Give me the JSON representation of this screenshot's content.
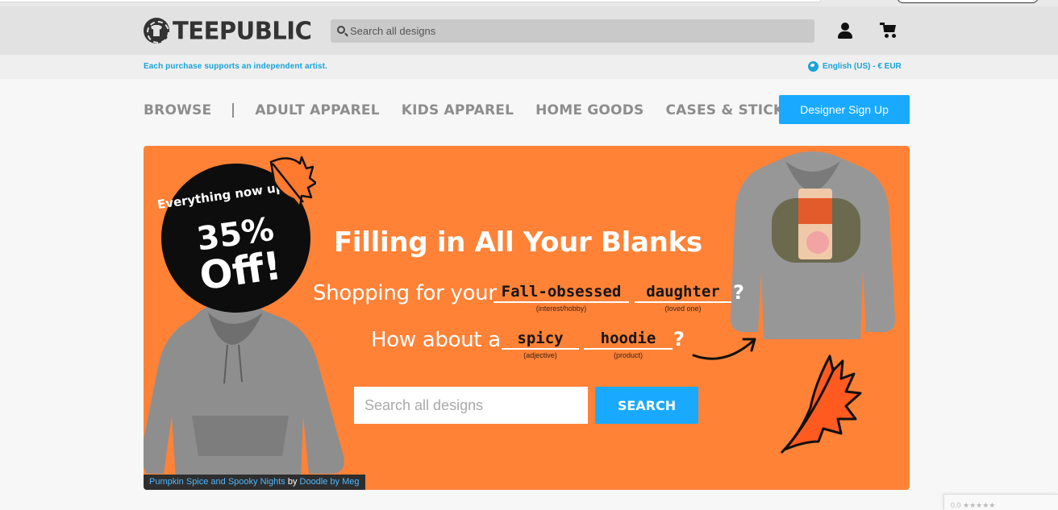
{
  "header": {
    "logo_text": "TEEPUBLIC",
    "search_placeholder": "Search all designs"
  },
  "substrip": {
    "tagline": "Each purchase supports an independent artist.",
    "locale": "English (US) - € EUR"
  },
  "nav": {
    "browse": "BROWSE",
    "items": [
      "ADULT APPAREL",
      "KIDS APPAREL",
      "HOME GOODS",
      "CASES & STICKERS"
    ],
    "signup_label": "Designer Sign Up"
  },
  "banner": {
    "badge": {
      "line1": "Everything now up to",
      "line2": "35%",
      "line3": "Off!"
    },
    "headline": "Filling in All Your Blanks",
    "line2_prefix": "Shopping for your",
    "blank1": {
      "word": "Fall-obsessed",
      "hint": "(interest/hobby)"
    },
    "blank2": {
      "word": "daughter",
      "hint": "(loved one)"
    },
    "line3_prefix": "How about a",
    "blank3": {
      "word": "spicy",
      "hint": "(adjective)"
    },
    "blank4": {
      "word": "hoodie",
      "hint": "(product)"
    },
    "qmark": "?",
    "search_placeholder": "Search all designs",
    "search_button": "SEARCH",
    "credit": {
      "design": "Pumpkin Spice and Spooky Nights",
      "by": "by",
      "artist": "Doodle by Meg"
    }
  },
  "recaptcha": {
    "text": "0.0 ★★★★★"
  },
  "colors": {
    "accent": "#19aaff",
    "banner": "#ff8237",
    "link": "#1aa3d9"
  }
}
